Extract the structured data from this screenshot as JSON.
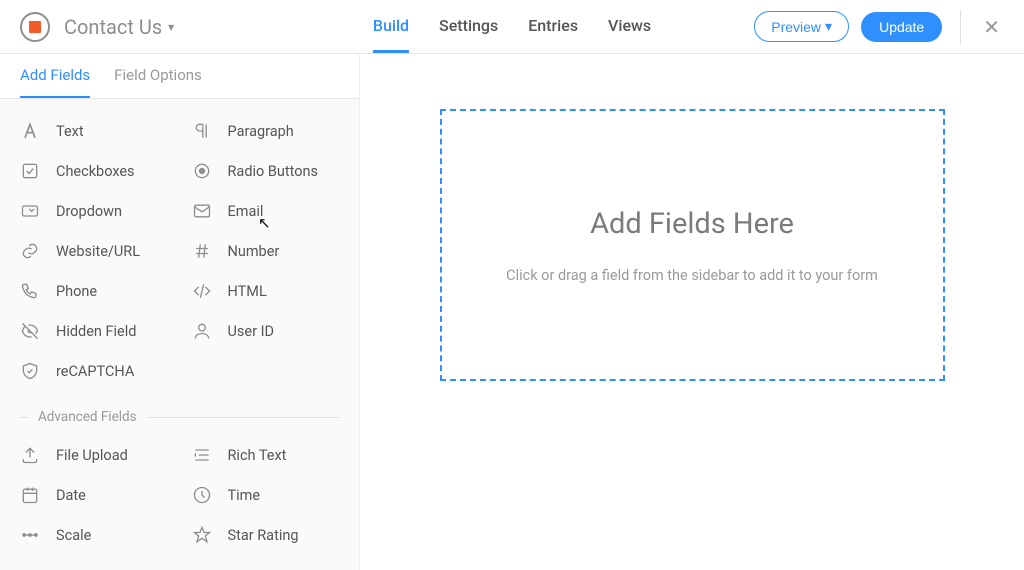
{
  "header": {
    "form_title": "Contact Us",
    "tabs": [
      "Build",
      "Settings",
      "Entries",
      "Views"
    ],
    "active_tab": "Build",
    "preview_label": "Preview",
    "update_label": "Update"
  },
  "sidebar": {
    "tabs": [
      "Add Fields",
      "Field Options"
    ],
    "active_tab": "Add Fields",
    "basic_fields": [
      {
        "icon": "text-a",
        "label": "Text"
      },
      {
        "icon": "paragraph",
        "label": "Paragraph"
      },
      {
        "icon": "checkbox",
        "label": "Checkboxes"
      },
      {
        "icon": "radio",
        "label": "Radio Buttons"
      },
      {
        "icon": "dropdown",
        "label": "Dropdown"
      },
      {
        "icon": "email",
        "label": "Email"
      },
      {
        "icon": "link",
        "label": "Website/URL"
      },
      {
        "icon": "hash",
        "label": "Number"
      },
      {
        "icon": "phone",
        "label": "Phone"
      },
      {
        "icon": "html",
        "label": "HTML"
      },
      {
        "icon": "eye-off",
        "label": "Hidden Field"
      },
      {
        "icon": "user",
        "label": "User ID"
      },
      {
        "icon": "shield",
        "label": "reCAPTCHA"
      }
    ],
    "section_advanced": "Advanced Fields",
    "advanced_fields": [
      {
        "icon": "upload",
        "label": "File Upload"
      },
      {
        "icon": "richtext",
        "label": "Rich Text"
      },
      {
        "icon": "date",
        "label": "Date"
      },
      {
        "icon": "time",
        "label": "Time"
      },
      {
        "icon": "scale",
        "label": "Scale"
      },
      {
        "icon": "star",
        "label": "Star Rating"
      }
    ]
  },
  "canvas": {
    "title": "Add Fields Here",
    "subtitle": "Click or drag a field from the sidebar to add it to your form"
  }
}
